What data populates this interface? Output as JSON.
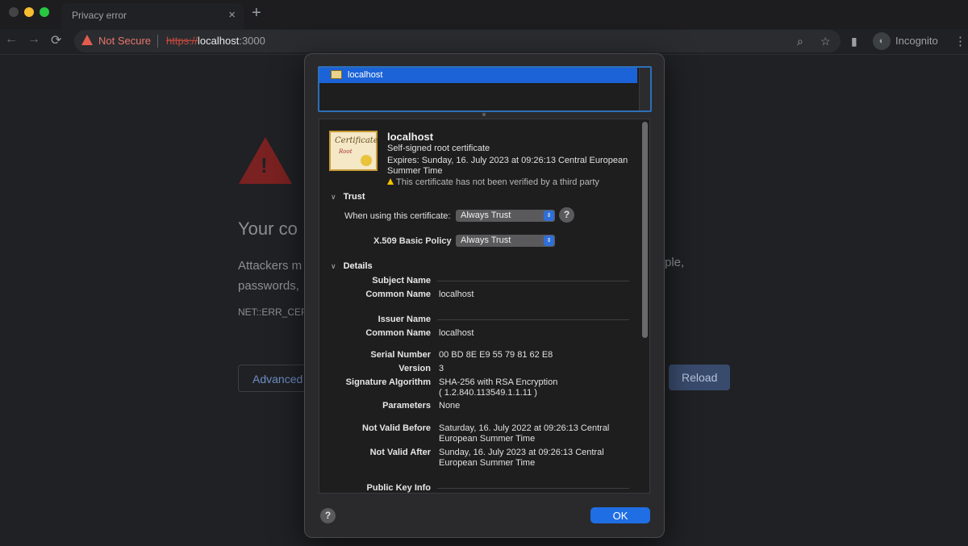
{
  "browser": {
    "tab_title": "Privacy error",
    "tab_close": "×",
    "new_tab": "+",
    "omnibox": {
      "security_label": "Not Secure",
      "url_scheme": "https://",
      "url_host": "localhost",
      "url_port": ":3000"
    },
    "profile_label": "Incognito"
  },
  "page": {
    "heading": "Your co",
    "paragraph_line1": "Attackers m",
    "paragraph_line2": "passwords, ",
    "paragraph_right": "ple,",
    "error_code": "NET::ERR_CEF",
    "advanced_label": "Advanced",
    "reload_label": "Reload"
  },
  "dialog": {
    "list_item": "localhost",
    "cert": {
      "badge_line1": "Certificate",
      "badge_line2": "Root",
      "title": "localhost",
      "subtitle": "Self-signed root certificate",
      "expires": "Expires: Sunday, 16. July 2023 at 09:26:13 Central European Summer Time",
      "warning": "This certificate has not been verified by a third party"
    },
    "trust": {
      "header": "Trust",
      "when_using_label": "When using this certificate:",
      "when_using_value": "Always Trust",
      "x509_label": "X.509 Basic Policy",
      "x509_value": "Always Trust"
    },
    "details": {
      "header": "Details",
      "subject_name_group": "Subject Name",
      "subject_cn_label": "Common Name",
      "subject_cn_value": "localhost",
      "issuer_name_group": "Issuer Name",
      "issuer_cn_label": "Common Name",
      "issuer_cn_value": "localhost",
      "serial_label": "Serial Number",
      "serial_value": "00 BD 8E E9 55 79 81 62 E8",
      "version_label": "Version",
      "version_value": "3",
      "sigalg_label": "Signature Algorithm",
      "sigalg_value": "SHA-256 with RSA Encryption",
      "sigalg_oid": "( 1.2.840.113549.1.1.11 )",
      "params_label": "Parameters",
      "params_value": "None",
      "not_before_label": "Not Valid Before",
      "not_before_value": "Saturday, 16. July 2022 at 09:26:13 Central European Summer Time",
      "not_after_label": "Not Valid After",
      "not_after_value": "Sunday, 16. July 2023 at 09:26:13 Central European Summer Time",
      "pubkey_group": "Public Key Info"
    },
    "help": "?",
    "ok_label": "OK"
  }
}
